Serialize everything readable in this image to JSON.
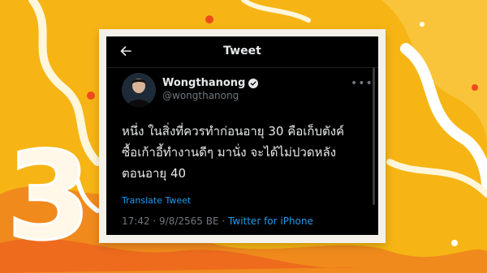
{
  "header": {
    "title": "Tweet",
    "back_icon": "arrow-left-icon"
  },
  "tweet": {
    "author_name": "Wongthanong",
    "verified_icon": "verified-badge-icon",
    "handle": "@wongthanong",
    "more_icon": "more-horizontal-icon",
    "text_lines": [
      "หนึ่ง ในสิ่งที่ควรทำก่อนอายุ 30 คือเก็บตังค์",
      "ซื้อเก้าอี้ทำงานดีๆ มานั่ง จะได้ไม่ปวดหลัง",
      "ตอนอายุ 40"
    ],
    "translate_label": "Translate Tweet",
    "time": "17:42",
    "date": "9/8/2565 BE",
    "separator": " · ",
    "source": "Twitter for iPhone"
  },
  "background": {
    "decor_text": "3",
    "colors": {
      "primary": "#f6b514",
      "accent": "#f26a21",
      "highlight": "#ffffff"
    }
  },
  "colors": {
    "screen_bg": "#000000",
    "text": "#e7e9ea",
    "muted": "#71767b",
    "link": "#1d9bf0"
  }
}
